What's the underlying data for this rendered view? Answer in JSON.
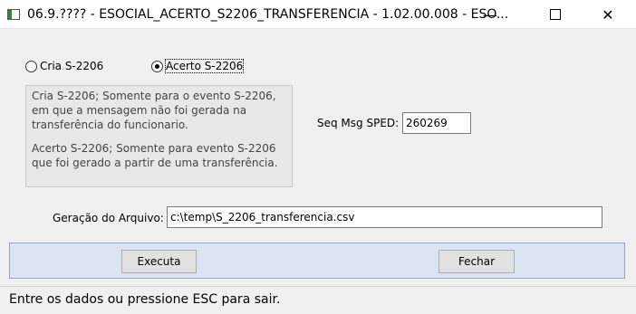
{
  "window": {
    "title": "06.9.???? - ESOCIAL_ACERTO_S2206_TRANSFERENCIA - 1.02.00.008 - ESO...",
    "minimize_glyph": "—",
    "close_glyph": "✕"
  },
  "options": {
    "cria_label": "Cria S-2206",
    "cria_selected": false,
    "acerto_label": "Acerto S-2206",
    "acerto_selected": true
  },
  "info": {
    "cria_text": "    Cria S-2206; Somente para o evento S-2206,\nem que a mensagem não foi gerada na\ntransferência do funcionario.",
    "acerto_text": "    Acerto S-2206; Somente para evento S-2206\nque foi gerado a partir de uma transferência."
  },
  "seq": {
    "label": "Seq Msg SPED:",
    "value": "260269"
  },
  "arquivo": {
    "label": "Geração do Arquivo:",
    "value": "c:\\temp\\S_2206_transferencia.csv"
  },
  "buttons": {
    "executa": "Executa",
    "fechar": "Fechar"
  },
  "status": {
    "text": "Entre os dados ou pressione ESC para sair."
  },
  "colors": {
    "panel": "#dce3f2",
    "info_bg": "#e8e8e8",
    "window_bg": "#f0f0f0"
  }
}
